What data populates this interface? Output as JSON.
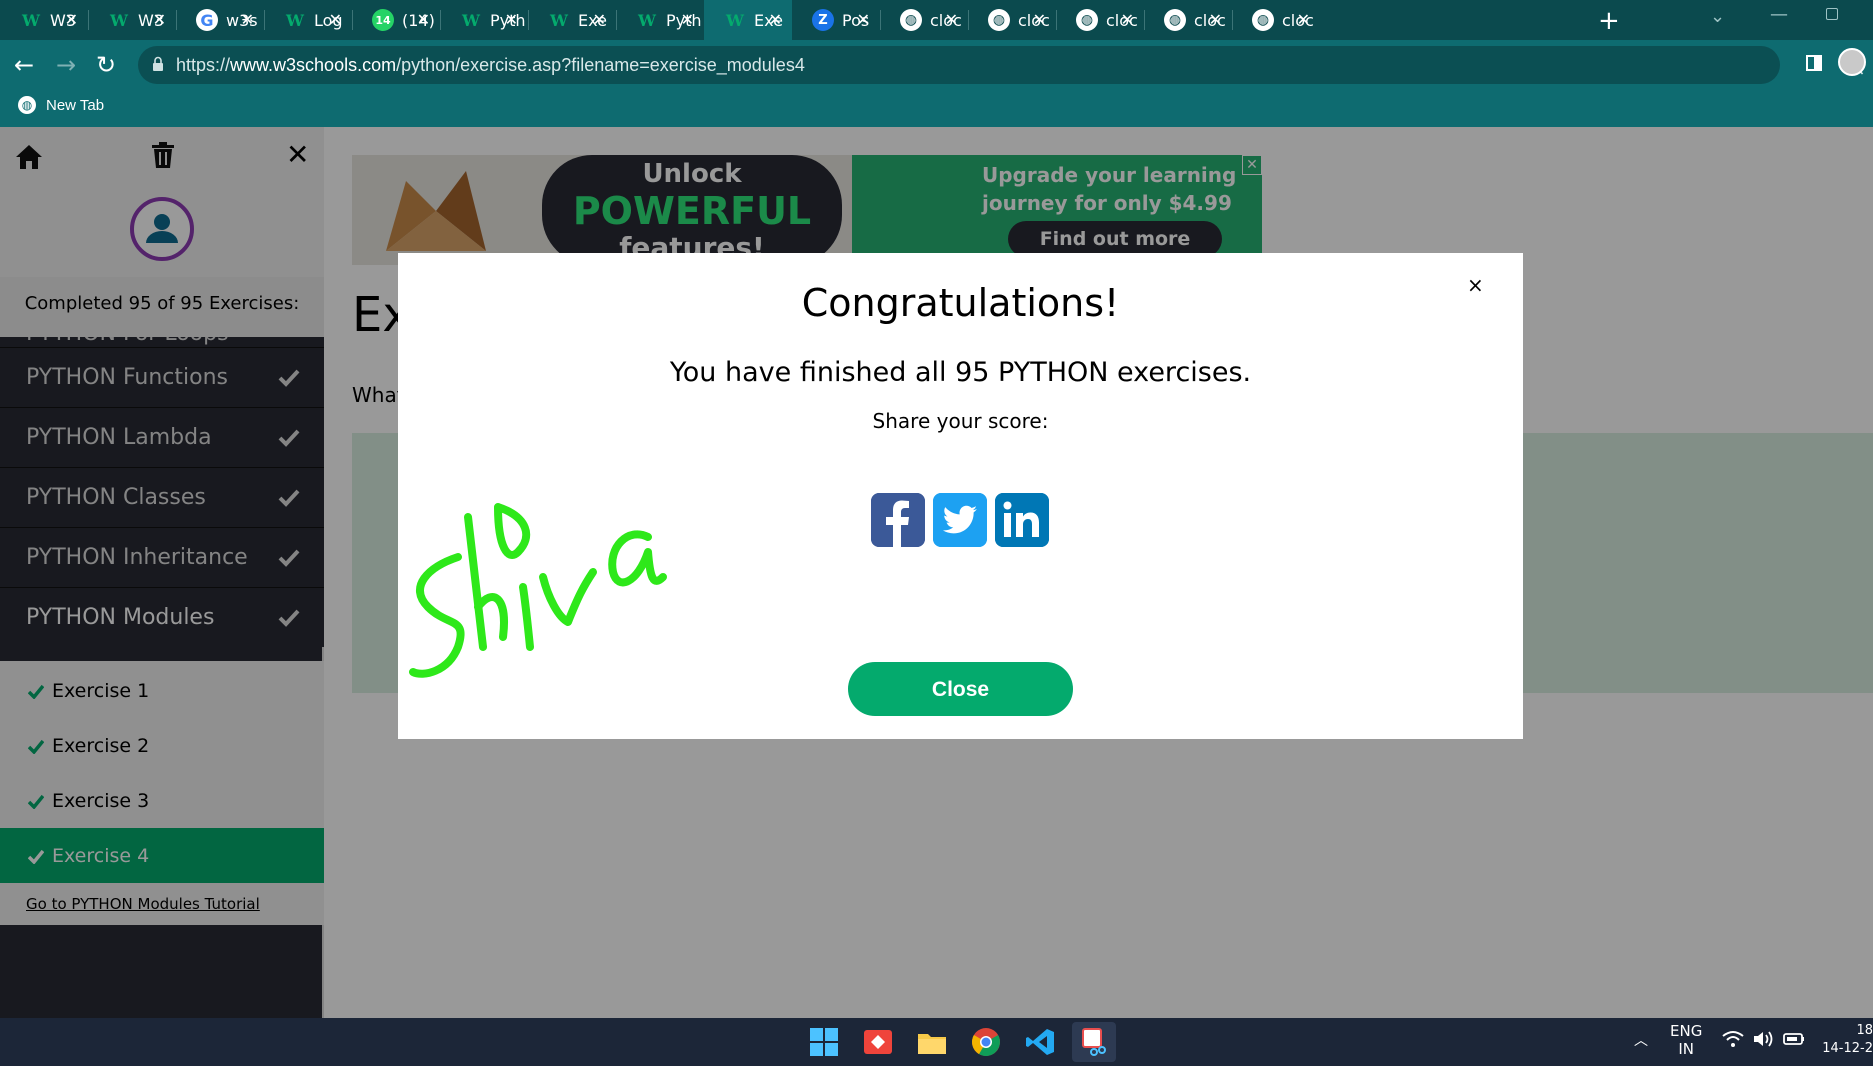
{
  "browser": {
    "tabs": [
      {
        "label": "W3",
        "icon": "w3schools-icon"
      },
      {
        "label": "W3",
        "icon": "w3schools-icon"
      },
      {
        "label": "w3s",
        "icon": "google-icon"
      },
      {
        "label": "Log",
        "icon": "w3schools-icon"
      },
      {
        "label": "(14)",
        "icon": "whatsapp-icon"
      },
      {
        "label": "Pyth",
        "icon": "w3schools-icon"
      },
      {
        "label": "Exe",
        "icon": "w3schools-icon"
      },
      {
        "label": "Pyth",
        "icon": "w3schools-icon"
      },
      {
        "label": "Exe",
        "icon": "w3schools-icon",
        "active": true
      },
      {
        "label": "Pos",
        "icon": "zoom-icon"
      },
      {
        "label": "cloc",
        "icon": "globe-icon"
      },
      {
        "label": "cloc",
        "icon": "globe-icon"
      },
      {
        "label": "cloc",
        "icon": "globe-icon"
      },
      {
        "label": "cloc",
        "icon": "globe-icon"
      },
      {
        "label": "cloc",
        "icon": "globe-icon"
      }
    ],
    "url_prefix": "https://",
    "url_domain": "www.w3schools.com",
    "url_path": "/python/exercise.asp?filename=exercise_modules4",
    "bookmark": "New Tab"
  },
  "sidebar": {
    "progress": "Completed 95 of 95 Exercises:",
    "cut_item": "PYTHON For Loops",
    "modules": [
      {
        "label": "PYTHON Functions",
        "done": true
      },
      {
        "label": "PYTHON Lambda",
        "done": true
      },
      {
        "label": "PYTHON Classes",
        "done": true
      },
      {
        "label": "PYTHON Inheritance",
        "done": true
      },
      {
        "label": "PYTHON Modules",
        "done": true
      }
    ],
    "exercises": [
      "Exercise 1",
      "Exercise 2",
      "Exercise 3",
      "Exercise 4"
    ],
    "selected_exercise": "Exercise 4",
    "tutorial_link": "Go to PYTHON Modules Tutorial"
  },
  "ad": {
    "unlock": "Unlock",
    "powerful": "POWERFUL",
    "features": "features!",
    "upgrade_line1": "Upgrade your learning",
    "upgrade_line2": "journey for only $4.99",
    "cta": "Find out more",
    "close": "✕"
  },
  "main": {
    "heading": "Ex",
    "question": "What"
  },
  "modal": {
    "title": "Congratulations!",
    "message": "You have finished all 95 PYTHON exercises.",
    "share": "Share your score:",
    "close_label": "Close",
    "close_x": "×",
    "signature": "Shiva"
  },
  "taskbar": {
    "lang_line1": "ENG",
    "lang_line2": "IN",
    "time": "18",
    "date": "14-12-2"
  },
  "colors": {
    "chrome": "#0e6b70",
    "accent": "#04aa6d",
    "scribble": "#2ee81a"
  }
}
